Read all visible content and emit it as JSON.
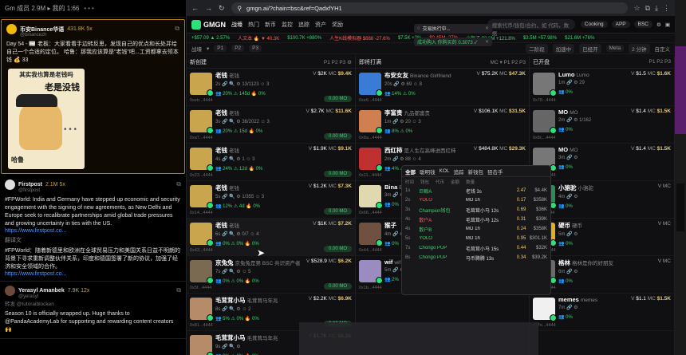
{
  "left": {
    "topbar": "Gm 成员 2.9M ▸ 我的 1:66",
    "posts": [
      {
        "name": "币安Binance华语",
        "badge": "431.8K 5x",
        "handle": "@binancezh",
        "body": "Day 54 - 📰 老板：大家看看手边转反思，发现自己的优点和长处并给自己一个合适的定位。 哈鲁：那我应该算是\"老钱\"吧...工资都拿去领本钱 💰 33",
        "meme_top": "其实我也算是老钱吗",
        "meme_mid": "老是没钱",
        "meme_bot": "哈鲁"
      },
      {
        "name": "Firstpost",
        "badge": "2.1M 5x",
        "handle": "@firstpost",
        "body": "#FPWorld: India and Germany have stepped up economic and security engagement with the signing of new agreements, as New Delhi and Europe seek to recalibrate partnerships amid global trade pressures and growing uncertainty in ties with the US.",
        "link": "https://www.firstpost.co...",
        "translate": "翻译文",
        "body2": "#FPWorld：随着新德里和欧洲在全球贸易压力和美国关系日益不明朗的背景下寻求重新调整伙伴关系，印度和德国签署了新的协议，加强了经济和安全领域的合作。",
        "link2": "https://www.firstpost.co..."
      },
      {
        "name": "Yerasyl Amanbek",
        "badge": "7.9K 12x",
        "handle": "@yerasyl",
        "repost": "转发 @tutoraiblocken",
        "body": "Season 10 is officially wrapped up. Huge thanks to @PandaAcademyLab for supporting and rewarding content creators 🙌"
      }
    ]
  },
  "browser": {
    "url": "gmgn.ai/?chain=bsc&ref=QadxfYH1",
    "logo": "GMGN",
    "nav": [
      "战壕",
      "热门",
      "新币",
      "监控",
      "追踪",
      "资产",
      "奖励"
    ],
    "search": "搜索代币/钱包/合约，如 代码，数据",
    "chain": "BSC",
    "navr": [
      "Cooking",
      "APP"
    ],
    "ticker": [
      "+$57.09 ▲ 2.57%",
      "人文本 🔥 ▼ 40.3K",
      "$100.7K +880%",
      "人生K线模拟器 $888 -27.6%",
      "$7.5K +2%",
      "$0.45M -27%",
      "小猴子 $3.6M +121.8%",
      "$3.5M +57.98%",
      "$21.6M +76%"
    ],
    "subbar": [
      "战壕",
      "▾",
      "Ⓜ",
      "Ⓜ",
      "P1",
      "P2",
      "P3",
      "二阶段",
      "加速中",
      "已经开",
      "Meta",
      "2 分钟",
      "自定义"
    ],
    "toasts": [
      "交易执行中...",
      "成功购入 你购买的 0.3073 ✓"
    ],
    "cols": [
      {
        "title": "新创建",
        "meta": "P1  P2  P3  ⚙"
      },
      {
        "title": "即将打满",
        "meta": "MC ▾  P1  P2  P3"
      },
      {
        "title": "已开盘",
        "meta": "P1  P2  P3"
      }
    ],
    "tokens1": [
      {
        "name": "老钱",
        "sub": "老钱",
        "meta": "2s 🔗 🔍 ⚙ 13/1123 ☺ 3",
        "addr": "0xeb...4444",
        "vol": "$2K",
        "mc": "$9.4K",
        "stats": "👥 20% ⚠ 145d 🔥 0%",
        "pct": "0.00 MO",
        "img": "#c9a54d"
      },
      {
        "name": "老钱",
        "sub": "老钱",
        "meta": "3s 🔗 🔍 ⚙ 36/2022 ☺ 3",
        "addr": "0xa7...4444",
        "vol": "$2.7K",
        "mc": "$11.6K",
        "stats": "👥 20% ⚠ 15d 🔥 0%",
        "pct": "0.00 MO",
        "img": "#c9a54d"
      },
      {
        "name": "老钱",
        "sub": "老钱",
        "meta": "4s 🔗 🔍 ⚙ 1 ☺ 3",
        "addr": "0x23...4444",
        "vol": "$1.9K",
        "mc": "$9.1K",
        "stats": "👥 24% ⚠ 12d 🔥 0%",
        "pct": "0.00 MO",
        "img": "#c9a54d"
      },
      {
        "name": "老钱",
        "sub": "老钱",
        "meta": "5s 🔗 🔍 ⚙ 1/355 ☺ 3",
        "addr": "0x14...4444",
        "vol": "$1.2K",
        "mc": "$7.3K",
        "stats": "👥 12% ⚠ 4d 🔥 0%",
        "pct": "0.00 MO",
        "img": "#c9a54d"
      },
      {
        "name": "老钱",
        "sub": "老钱",
        "meta": "6s 🔗 🔍 ⚙ 0/7 ☺ 4",
        "addr": "0x43...4444",
        "vol": "$1K",
        "mc": "$7.2K",
        "stats": "👥 0% ⚠ 0% 🔥 0%",
        "pct": "0.00 MO",
        "img": "#c9a54d"
      },
      {
        "name": "京兔兔",
        "sub": "京兔兔是第 BSC 共识资产者",
        "meta": "7s 🔗 🔍 ⚙ ☺ 5",
        "addr": "0x5f...4444",
        "vol": "$528.9",
        "mc": "$6.2K",
        "stats": "👥 0% ⚠ 0% 🔥 0%",
        "pct": "0.00 MO",
        "img": "#7a6a52"
      },
      {
        "name": "毛茸茸小马",
        "sub": "毛茸茸马年兆",
        "meta": "8s 🔗 🔍 ⚙ ☺ 2",
        "addr": "0x81...4444",
        "vol": "$2.2K",
        "mc": "$6.9K",
        "stats": "👥 5% ⚠ 0% 🔥 0%",
        "pct": "0.00 MO",
        "img": "#b58b6a"
      },
      {
        "name": "毛茸茸小马",
        "sub": "毛茸茸马年兆",
        "meta": "9s 🔗 🔍 ⚙",
        "addr": "0x9e...4444",
        "vol": "$1.7K",
        "mc": "$6.3K",
        "stats": "👥 0% ⚠ 0% 🔥 0%",
        "pct": "0.00 MO",
        "img": "#b58b6a"
      }
    ],
    "tokens2": [
      {
        "name": "布安女友",
        "sub": "Binance Girlfriend",
        "meta": "20s 🔗 ⚙ 69 ☺ 8",
        "addr": "0xe6...4444",
        "vol": "$75.2K",
        "mc": "$47.3K",
        "stats": "👥 14% ⚠ 0%",
        "img": "#3a7bd5"
      },
      {
        "name": "李富贵",
        "sub": "九品都富贵",
        "meta": "1m 🔗 ⚙ 20 ☺ 3",
        "addr": "0x8a...4444",
        "vol": "$106.1K",
        "mc": "$31.5K",
        "stats": "👥 8% ⚠ 0%",
        "img": "#d08050"
      },
      {
        "name": "西红柿",
        "sub": "是人生在高峰进西红柿",
        "meta": "2m 🔗 ⚙ 88 ☺ 4",
        "addr": "0x11...4444",
        "vol": "$484.8K",
        "mc": "$29.3K",
        "stats": "👥 4% ⚠ 0%",
        "img": "#c03030"
      },
      {
        "name": "Bina",
        "sub": "Binance",
        "meta": "3m 🔗 ⚙",
        "addr": "0x66...4444",
        "vol": "",
        "mc": "",
        "stats": "👥 0%",
        "img": "#e0d9b0"
      },
      {
        "name": "猴子",
        "sub": "",
        "meta": "4m 🔗 ⚙",
        "addr": "0x44...4444",
        "vol": "",
        "mc": "",
        "stats": "👥 0%",
        "img": "#705040"
      },
      {
        "name": "wif",
        "sub": "wif",
        "meta": "5m 🔗 ⚙",
        "addr": "0x1b...4444",
        "vol": "$57.2K",
        "mc": "$36.8K",
        "stats": "👥 2%",
        "img": "#9a8cc0"
      }
    ],
    "tokens3": [
      {
        "name": "Lumo",
        "sub": "Lumo",
        "meta": "1m 🔗 ⚙ 29",
        "addr": "0x78...4444",
        "vol": "$1.5",
        "mc": "$1.6K",
        "stats": "👥 0%",
        "img": "#777"
      },
      {
        "name": "MO",
        "sub": "MO",
        "meta": "2m 🔗 ⚙ 1/162",
        "addr": "0x8c...4444",
        "vol": "$1.4",
        "mc": "$1.5K",
        "stats": "👥 0%",
        "img": "#666"
      },
      {
        "name": "MO",
        "sub": "MO",
        "meta": "3m 🔗 ⚙",
        "addr": "0x31...4444",
        "vol": "$1.4",
        "mc": "$1.5K",
        "stats": "👥 0%",
        "img": "#777"
      },
      {
        "name": "小骆驼",
        "sub": "小骆驼",
        "meta": "4m 🔗 ⚙",
        "addr": "0x9f...4444",
        "vol": "",
        "mc": "",
        "stats": "👥 0%",
        "img": "#2d8a5a"
      },
      {
        "name": "硬币",
        "sub": "硬币",
        "meta": "5m 🔗 ⚙",
        "addr": "0x2a...4444",
        "vol": "",
        "mc": "",
        "stats": "👥 0%",
        "img": "#e0b020"
      },
      {
        "name": "格林",
        "sub": "格林是你的好朋友",
        "meta": "6m 🔗 ⚙",
        "addr": "0x5d...4444",
        "vol": "",
        "mc": "",
        "stats": "👥 0%",
        "img": "#6a6a6a"
      },
      {
        "name": "memes",
        "sub": "memes",
        "meta": "7m 🔗 ⚙",
        "addr": "0x7e...4444",
        "vol": "$1.1",
        "mc": "$1.5K",
        "stats": "👥 0%",
        "img": "#f0f0f0"
      }
    ],
    "popup": {
      "tabs": [
        "全部",
        "聪明钱",
        "KOL",
        "追踪",
        "新钱包",
        "狙击手"
      ],
      "headers": [
        "时间",
        "钱包",
        "代币",
        "金额",
        "数量"
      ],
      "rows": [
        {
          "ago": "1s",
          "who": "巨鲸A",
          "tk": "老钱 3s",
          "amt": "2.47",
          "sz": "$4.4K",
          "side": "buyer"
        },
        {
          "ago": "2s",
          "who": "YOLO",
          "tk": "MO 1h",
          "amt": "0.17",
          "sz": "$358K",
          "side": "seller"
        },
        {
          "ago": "3s",
          "who": "Champion钱包",
          "tk": "毛茸茸小马 12s",
          "amt": "0.69",
          "sz": "$36K",
          "side": "buyer"
        },
        {
          "ago": "4s",
          "who": "散户A",
          "tk": "毛茸茸小马 12s",
          "amt": "0.31",
          "sz": "$39K",
          "side": "seller"
        },
        {
          "ago": "4s",
          "who": "散户B",
          "tk": "MO 1h",
          "amt": "0.24",
          "sz": "$358K",
          "side": "buyer"
        },
        {
          "ago": "5s",
          "who": "YOLO",
          "tk": "MO 1h",
          "amt": "0.95",
          "sz": "$301.1K",
          "side": "buyer"
        },
        {
          "ago": "7s",
          "who": "Chongo PUP",
          "tk": "毛茸茸小马 15s",
          "amt": "0.44",
          "sz": "$32K",
          "side": "buyer"
        },
        {
          "ago": "8s",
          "who": "Chongo PUP",
          "tk": "马币腾腾 13s",
          "amt": "0.34",
          "sz": "$39.2K",
          "side": "buyer"
        }
      ]
    }
  }
}
